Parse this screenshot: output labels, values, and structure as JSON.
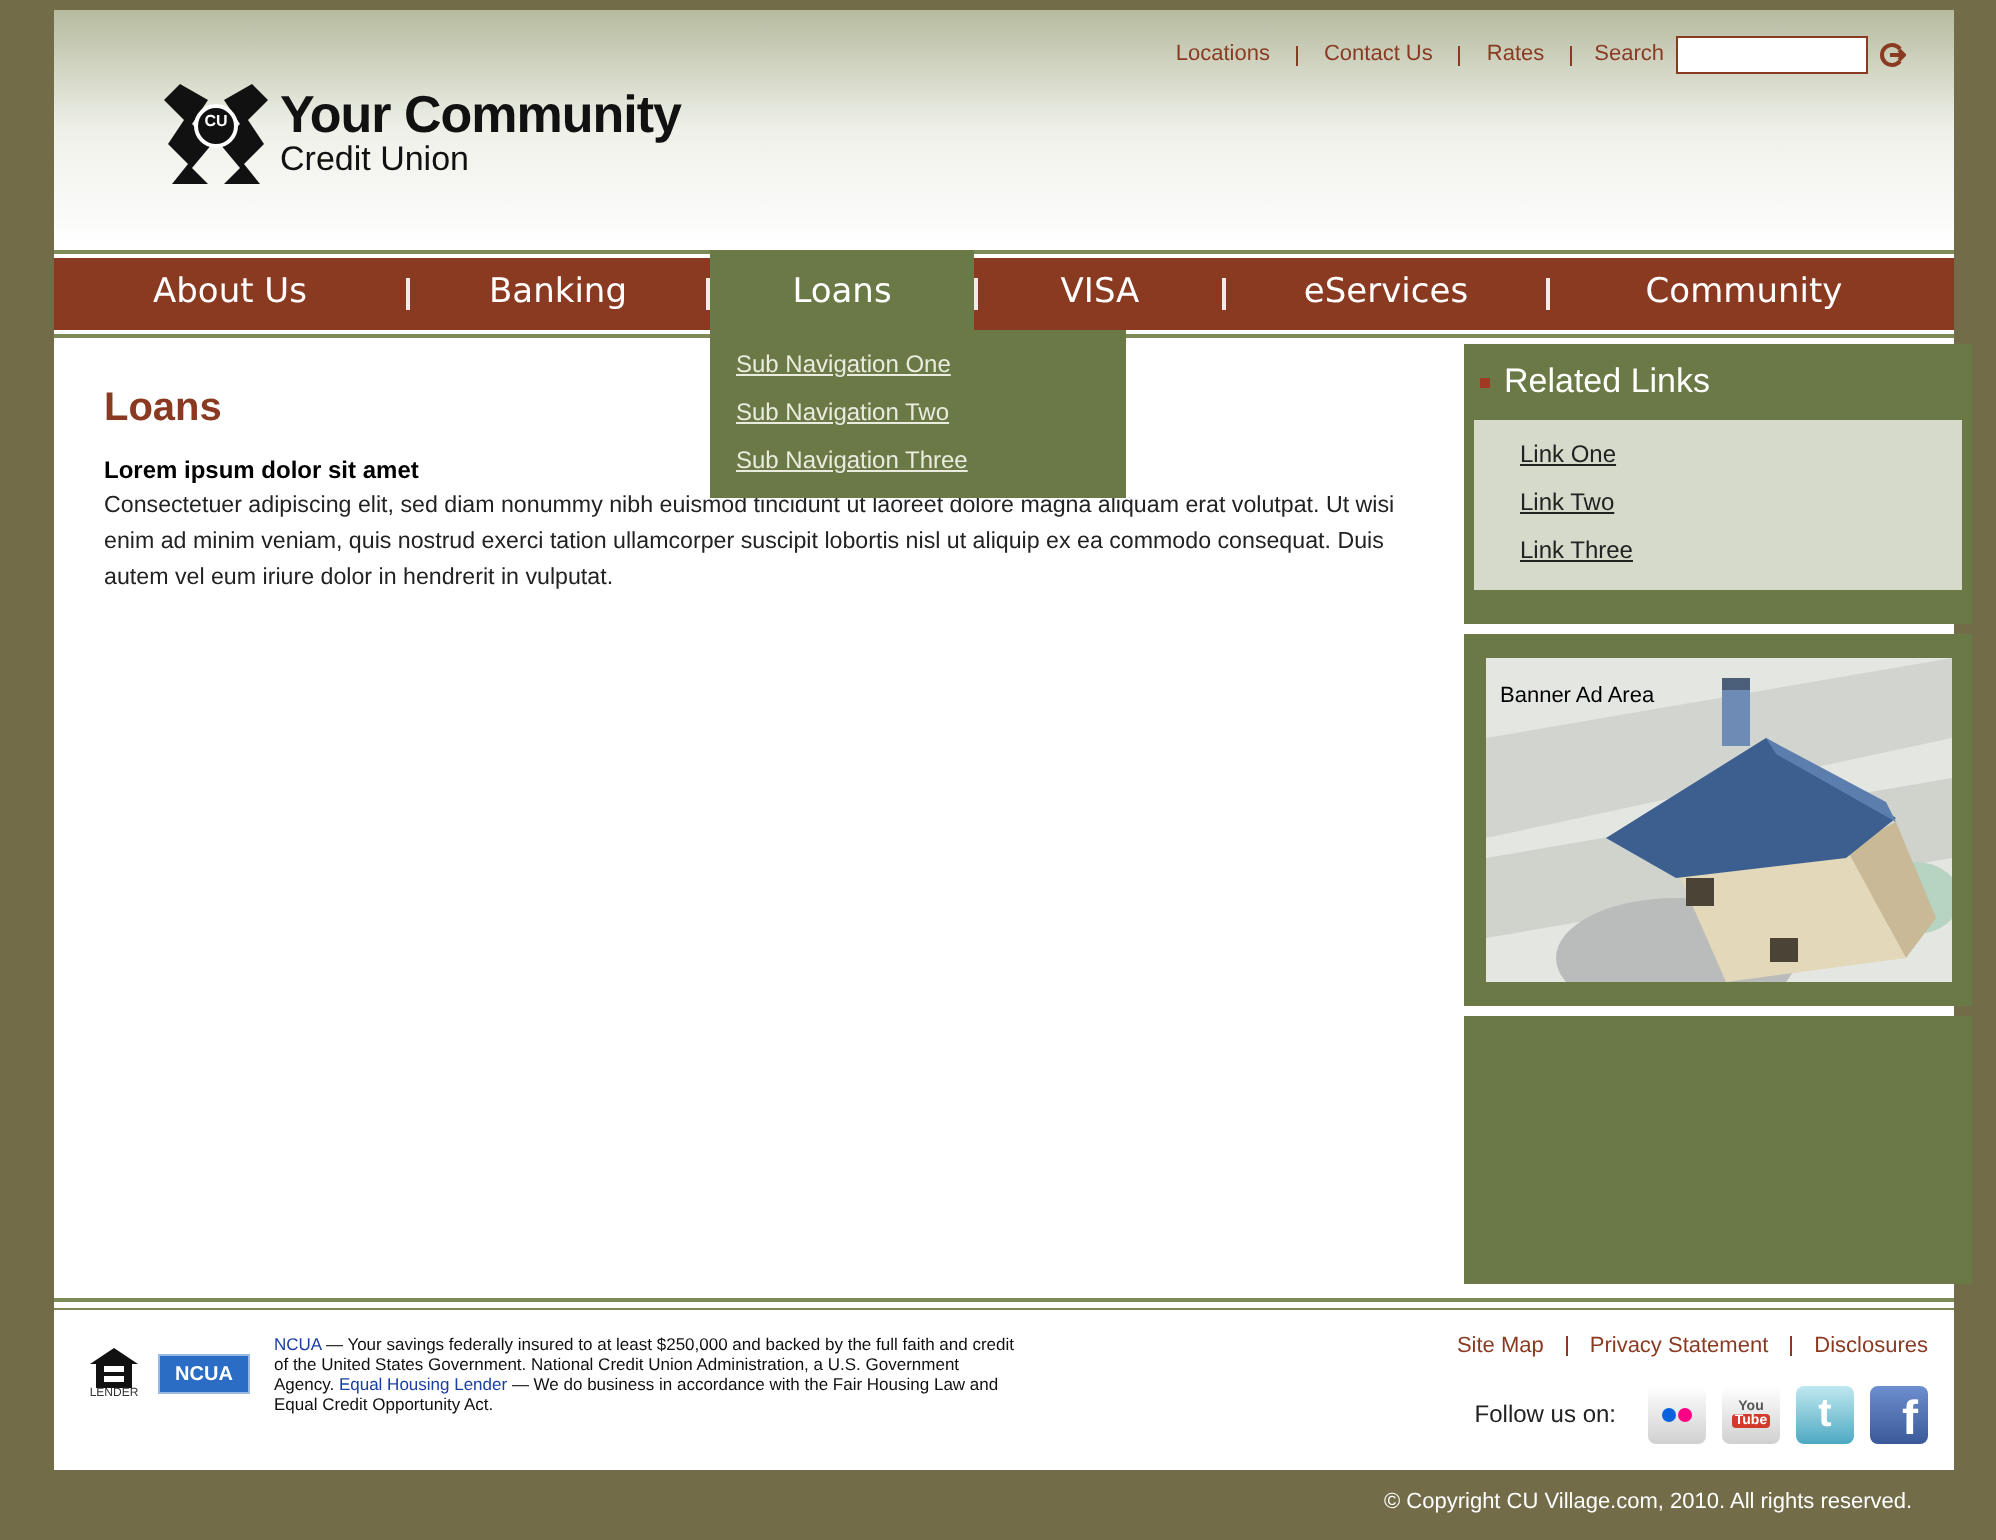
{
  "header": {
    "logo": {
      "badge": "CU",
      "name": "Your Community",
      "subname": "Credit Union"
    },
    "utility_links": [
      "Locations",
      "Contact Us",
      "Rates"
    ],
    "search_label": "Search"
  },
  "nav": [
    {
      "label": "About Us",
      "selected": false
    },
    {
      "label": "Banking",
      "selected": false
    },
    {
      "label": "Loans",
      "selected": true,
      "submenu": [
        "Sub Navigation One",
        "Sub Navigation Two",
        "Sub Navigation Three"
      ]
    },
    {
      "label": "VISA",
      "selected": false
    },
    {
      "label": "eServices",
      "selected": false
    },
    {
      "label": "Community",
      "selected": false
    }
  ],
  "content": {
    "title": "Loans",
    "subtitle": "Lorem ipsum dolor sit amet",
    "body": "Consectetuer adipiscing elit, sed diam nonummy nibh euismod tincidunt ut laoreet dolore magna aliquam erat volutpat. Ut wisi enim ad minim veniam, quis nostrud exerci tation ullamcorper suscipit lobortis nisl ut aliquip ex ea commodo consequat.  Duis autem vel eum iriure dolor in hendrerit in vulputat."
  },
  "sidebar": {
    "related_links": {
      "title": "Related Links",
      "links": [
        "Link One",
        "Link Two",
        "Link Three"
      ]
    },
    "banner": {
      "label": "Banner Ad Area",
      "kind": "picture"
    }
  },
  "footer": {
    "badges": {
      "housing": "LENDER",
      "ncua": "NCUA"
    },
    "disclosure": [
      {
        "kind": "link",
        "text": "NCUA"
      },
      {
        "kind": "text",
        "text": " — Your savings federally insured to at least $250,000 and backed by the full faith and credit of the United States Government. National Credit Union Administration, a U.S. Government Agency.  "
      },
      {
        "kind": "link",
        "text": "Equal Housing Lender"
      },
      {
        "kind": "text",
        "text": " — We do business in accordance with the Fair Housing Law and Equal Credit Opportunity Act."
      }
    ],
    "links": [
      "Site Map",
      "Privacy Statement",
      "Disclosures"
    ],
    "follow_label": "Follow us on:",
    "social": [
      {
        "kind": "flickr"
      },
      {
        "kind": "youtube",
        "text": "You",
        "text2": "Tube"
      },
      {
        "kind": "twitter",
        "text": "t"
      },
      {
        "kind": "facebook",
        "text": "f"
      }
    ],
    "copyright": "© Copyright CU Village.com, 2010. All rights reserved."
  }
}
